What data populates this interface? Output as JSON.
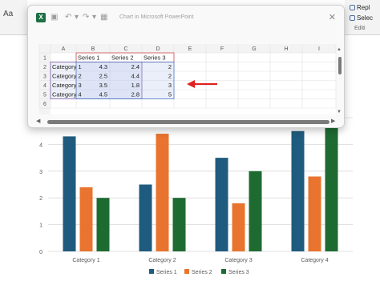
{
  "ribbon": {
    "font_size_label": "Aa",
    "replace_label": "Repl",
    "select_label": "Selec",
    "group_label": "Editi"
  },
  "dialog": {
    "title": "Chart in Microsoft PowerPoint",
    "app_icon": "excel-icon",
    "close_symbol": "✕",
    "columns": [
      "A",
      "B",
      "C",
      "D",
      "E",
      "F",
      "G",
      "H",
      "I"
    ],
    "rows": [
      "1",
      "2",
      "3",
      "4",
      "5",
      "6"
    ],
    "headers": [
      "Series 1",
      "Series 2",
      "Series 3"
    ],
    "data_rows": [
      {
        "category": "Category 1",
        "values": [
          "4.3",
          "2.4",
          "2"
        ]
      },
      {
        "category": "Category 2",
        "values": [
          "2.5",
          "4.4",
          "2"
        ]
      },
      {
        "category": "Category 3",
        "values": [
          "3.5",
          "1.8",
          "3"
        ]
      },
      {
        "category": "Category 4",
        "values": [
          "4.5",
          "2.8",
          "5"
        ]
      }
    ],
    "annotation_arrow_color": "#e02020"
  },
  "chart_data": {
    "type": "bar",
    "categories": [
      "Category 1",
      "Category 2",
      "Category 3",
      "Category 4"
    ],
    "series": [
      {
        "name": "Series 1",
        "values": [
          4.3,
          2.5,
          3.5,
          4.5
        ],
        "color": "#1f5b7e"
      },
      {
        "name": "Series 2",
        "values": [
          2.4,
          4.4,
          1.8,
          2.8
        ],
        "color": "#e8742f"
      },
      {
        "name": "Series 3",
        "values": [
          2,
          2,
          3,
          5
        ],
        "color": "#1e6b32"
      }
    ],
    "y_ticks": [
      "0",
      "1",
      "2",
      "3",
      "4"
    ],
    "ylim": [
      0,
      5
    ],
    "legend": "bottom",
    "grid": true
  }
}
